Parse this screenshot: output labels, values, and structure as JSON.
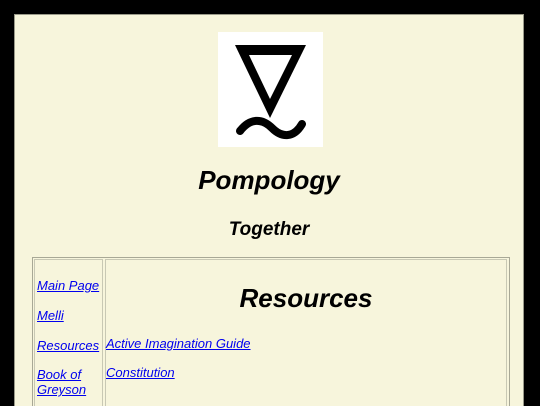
{
  "header": {
    "logo_icon": "pompology-sigil-icon",
    "title": "Pompology",
    "subtitle": "Together"
  },
  "nav": {
    "items": [
      {
        "label": "Main Page"
      },
      {
        "label": "Melli"
      },
      {
        "label": "Resources"
      },
      {
        "label": "Book of Greyson"
      }
    ]
  },
  "main": {
    "heading": "Resources",
    "links": [
      {
        "label": "Active Imagination Guide"
      },
      {
        "label": "Constitution"
      }
    ]
  },
  "colors": {
    "page_background": "#000000",
    "panel_background": "#f7f5dc",
    "link": "#0000ee"
  }
}
